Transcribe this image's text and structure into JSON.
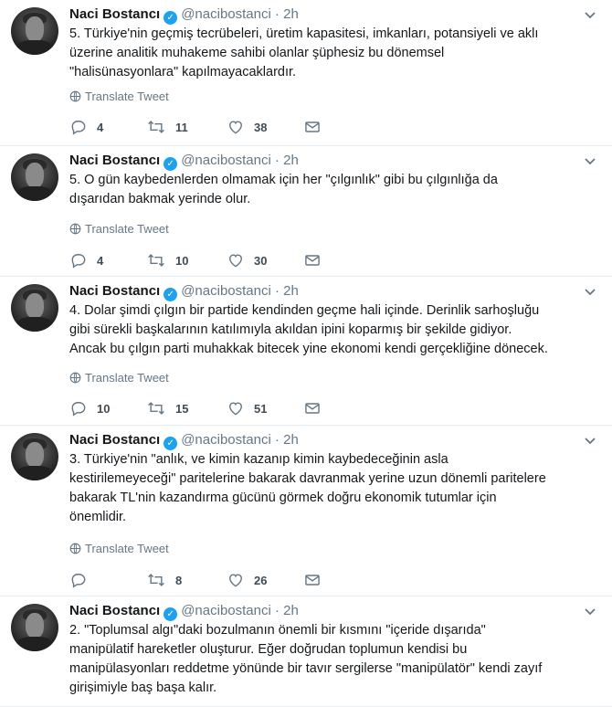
{
  "tweets": [
    {
      "name": "Naci Bostancı",
      "handle": "@nacibostanci",
      "sep": "·",
      "time": "2h",
      "lines": [
        "5. Türkiye'nin geçmiş tecrübeleri, üretim kapasitesi, imkanları, potansiyeli ve aklı",
        "üzerine analitik muhakeme sahibi olanlar şüphesiz bu dönemsel",
        "\"halisünasyonlara\" kapılmayacaklardır."
      ],
      "translate": "Translate Tweet",
      "replies": "4",
      "retweets": "11",
      "likes": "38"
    },
    {
      "name": "Naci Bostancı",
      "handle": "@nacibostanci",
      "sep": "·",
      "time": "2h",
      "lines": [
        "5. O gün kaybedenlerden olmamak için her \"çılgınlık\" gibi bu çılgınlığa da",
        "dışarıdan bakmak yerinde olur."
      ],
      "translate": "Translate Tweet",
      "replies": "4",
      "retweets": "10",
      "likes": "30"
    },
    {
      "name": "Naci Bostancı",
      "handle": "@nacibostanci",
      "sep": "·",
      "time": "2h",
      "lines": [
        "4. Dolar şimdi çılgın bir partide kendinden geçme hali içinde. Derinlik sarhoşluğu",
        "gibi sürekli başkalarının katılımıyla akıldan ipini koparmış bir şekilde gidiyor.",
        "Ancak bu çılgın parti muhakkak bitecek yine ekonomi kendi gerçekliğine dönecek."
      ],
      "translate": "Translate Tweet",
      "replies": "10",
      "retweets": "15",
      "likes": "51"
    },
    {
      "name": "Naci Bostancı",
      "handle": "@nacibostanci",
      "sep": "·",
      "time": "2h",
      "lines": [
        "3. Türkiye'nin \"anlık, ve kimin kazanıp kimin kaybedeceğinin asla",
        "kestirilemeyeceği\" paritelerine bakarak davranmak yerine uzun dönemli paritelere",
        "bakarak TL'nin kazandırma gücünü görmek doğru ekonomik tutumlar için",
        "önemlidir."
      ],
      "translate": "Translate Tweet",
      "replies": "",
      "retweets": "8",
      "likes": "26"
    },
    {
      "name": "Naci Bostancı",
      "handle": "@nacibostanci",
      "sep": "·",
      "time": "2h",
      "lines": [
        "2. \"Toplumsal algı\"daki bozulmanın önemli bir kısmını \"içeride dışarıda\"",
        "manipülatif hareketler oluşturur. Eğer doğrudan toplumun kendisi bu",
        "manipülasyonları reddetme yönünde bir tavır sergilerse \"manipülatör\" kendi zayıf",
        "girişimiyle baş başa kalır."
      ],
      "translate": "",
      "replies": "",
      "retweets": "",
      "likes": ""
    }
  ],
  "colors": {
    "accent": "#1da1f2",
    "muted": "#657786",
    "text": "#14171a"
  },
  "icons": [
    "verified-badge-icon",
    "chevron-down-icon",
    "globe-icon",
    "reply-icon",
    "retweet-icon",
    "like-icon",
    "message-icon"
  ]
}
